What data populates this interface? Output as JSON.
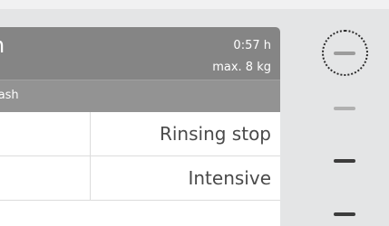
{
  "program": {
    "title": "n",
    "duration": "0:57 h",
    "max_load": "max. 8 kg",
    "subtitle": "vash"
  },
  "options": [
    {
      "label": "Rinsing stop"
    },
    {
      "label": "Intensive"
    }
  ],
  "rail": {
    "items": [
      "minus-icon",
      "dash-icon",
      "dash-icon",
      "dash-icon"
    ],
    "colors": {
      "light": "#a9a9a9",
      "dark": "#3c3c3c"
    }
  }
}
